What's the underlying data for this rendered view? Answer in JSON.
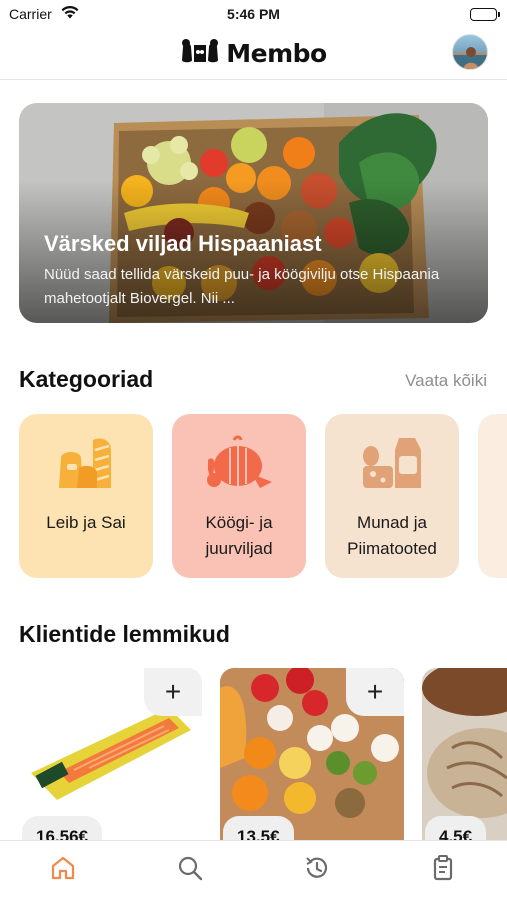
{
  "status_bar": {
    "carrier": "Carrier",
    "time": "5:46 PM"
  },
  "header": {
    "brand": "Membo"
  },
  "banner": {
    "title": "Värsked viljad Hispaaniast",
    "text": "Nüüd saad tellida värskeid puu- ja köögivilju otse Hispaania mahetootjalt Biovergel. Nii ..."
  },
  "categories": {
    "title": "Kategooriad",
    "see_all": "Vaata kõiki",
    "items": [
      {
        "label": "Leib ja Sai",
        "icon": "bread-icon",
        "color": "#fde3b2"
      },
      {
        "label": "Köögi- ja juurviljad",
        "icon": "vegetables-icon",
        "color": "#f9c2b4"
      },
      {
        "label": "Munad ja Piimatooted",
        "icon": "dairy-icon",
        "color": "#f5e2cf"
      }
    ]
  },
  "favorites": {
    "title": "Klientide lemmikud",
    "products": [
      {
        "price": "16.56€",
        "add": "+"
      },
      {
        "price": "13.5€",
        "add": "+"
      },
      {
        "price": "4.5€"
      }
    ]
  },
  "tabbar": {
    "active_color": "#f08a4b",
    "items": [
      "home-icon",
      "search-icon",
      "history-icon",
      "orders-icon"
    ]
  }
}
